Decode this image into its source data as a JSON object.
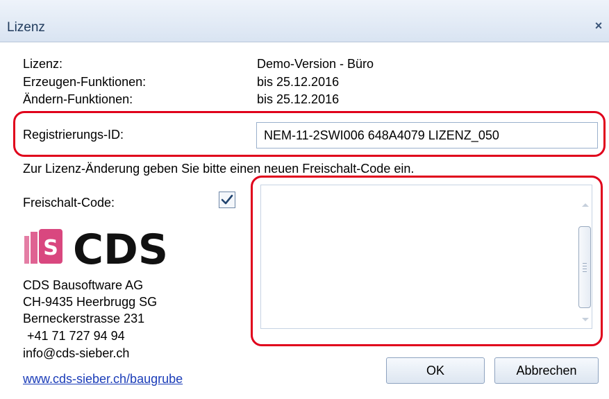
{
  "window": {
    "title": "Lizenz",
    "close_glyph": "×"
  },
  "license": {
    "rows": [
      {
        "label": "Lizenz:",
        "value": "Demo-Version - Büro"
      },
      {
        "label": "Erzeugen-Funktionen:",
        "value": "bis 25.12.2016"
      },
      {
        "label": "Ändern-Funktionen:",
        "value": "bis 25.12.2016"
      }
    ]
  },
  "registration": {
    "label": "Registrierungs-ID:",
    "value": "NEM-11-2SWI006 648A4079 LIZENZ_050"
  },
  "instruction": "Zur Lizenz-Änderung geben Sie bitte einen neuen Freischalt-Code ein.",
  "unlock": {
    "label": "Freischalt-Code:",
    "checked": true,
    "value": ""
  },
  "company": {
    "logo_text": "CDS",
    "logo_color": "#d9477f",
    "lines": [
      "CDS Bausoftware AG",
      "CH-9435 Heerbrugg SG",
      "Berneckerstrasse 231",
      "+41 71 727 94 94",
      "info@cds-sieber.ch"
    ],
    "link": "www.cds-sieber.ch/baugrube"
  },
  "buttons": {
    "ok": "OK",
    "cancel": "Abbrechen"
  },
  "highlight_color": "#e0001b"
}
